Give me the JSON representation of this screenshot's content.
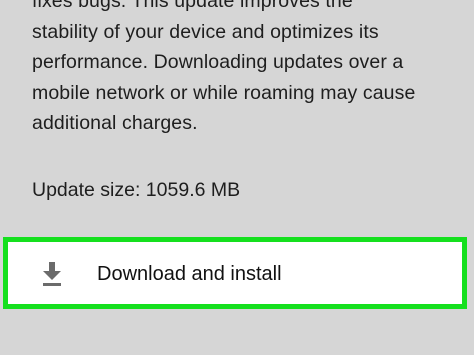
{
  "content": {
    "description": "fixes bugs. This update improves the\nstability of your device and optimizes its\nperformance. Downloading updates over a\nmobile network or while roaming may cause\nadditional charges.",
    "update_size": "Update size: 1059.6 MB"
  },
  "download_button": {
    "label": "Download and install",
    "icon": "download-icon",
    "highlight_color": "#15e01e"
  }
}
